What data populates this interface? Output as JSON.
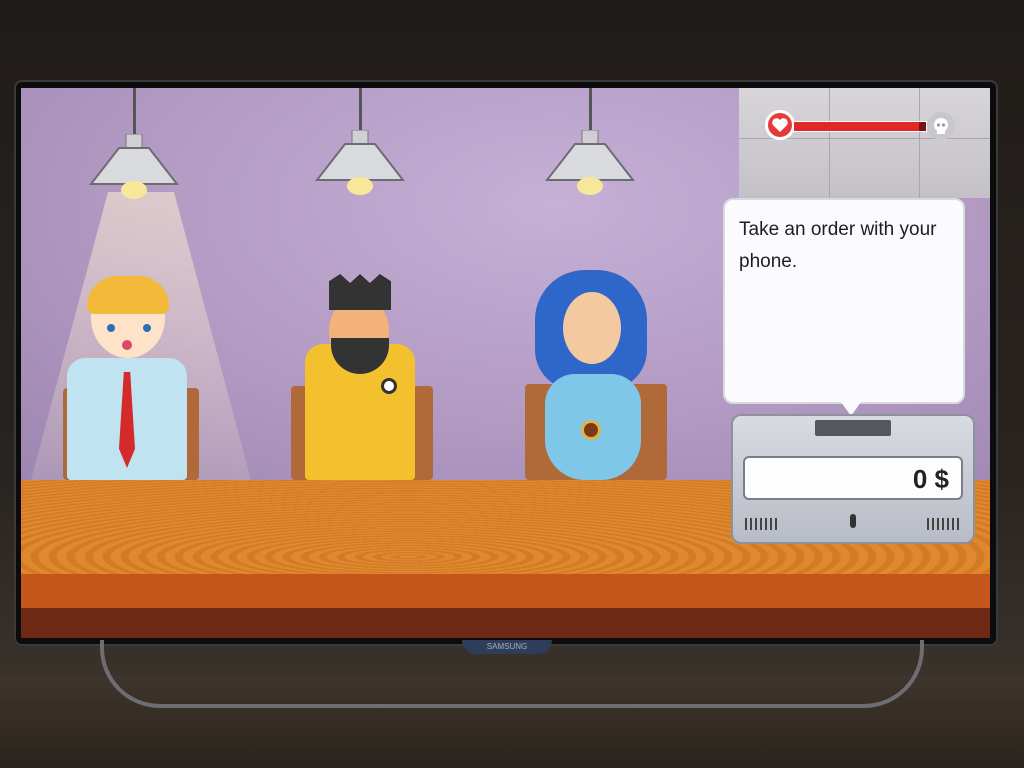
{
  "hud": {
    "health_fraction": 0.95,
    "heart_icon": "heart-icon",
    "skull_icon": "skull-icon",
    "health_color": "#e02828"
  },
  "speech": {
    "text": "Take an order with your phone."
  },
  "register": {
    "amount": "0 $"
  },
  "tv": {
    "brand": "SAMSUNG"
  },
  "colors": {
    "wall": "#b29ac3",
    "counter": "#e0882e",
    "counter_front": "#c4561c"
  }
}
